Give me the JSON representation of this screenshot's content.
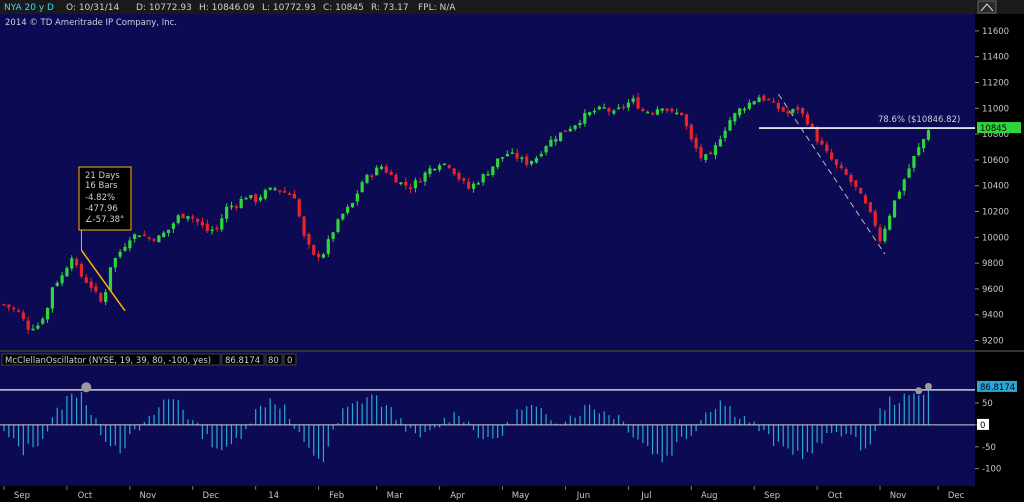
{
  "header": {
    "symbol": "NYA 20 y D",
    "open": "O: 10/31/14",
    "date_open": "D: 10772.93",
    "high": "H: 10846.09",
    "low": "L: 10772.93",
    "close": "C: 10845",
    "range": "R: 73.17",
    "fpl": "FPL: N/A",
    "copyright": "2014 © TD Ameritrade IP Company, Inc."
  },
  "colors": {
    "bg": "#0b0a52",
    "up": "#2fd63a",
    "down": "#e8242a",
    "fib": "#ffffff",
    "osc": "#2aa7d8",
    "annot": "#ffb400"
  },
  "annotation": {
    "lines": [
      "21 Days",
      "16 Bars",
      "-4.82%",
      "-477.96",
      "∠-57.38°"
    ]
  },
  "fib_label": "78.6% ($10846.82)",
  "price_tag": "10845",
  "osc_header": {
    "name": "McClellanOscillator (NYSE, 19, 39, 80, -100, yes)",
    "value": "86.8174",
    "level": "80",
    "zero": "0"
  },
  "osc_tag": "86.8174",
  "osc_zero_tag": "0",
  "chart_data": [
    {
      "type": "candlestick",
      "title": "NYA 20 y D",
      "ylim": [
        9150,
        11700
      ],
      "y_ticks": [
        9200,
        9400,
        9600,
        9800,
        10000,
        10200,
        10400,
        10600,
        10800,
        11000,
        11200,
        11400,
        11600
      ],
      "x_labels": [
        "Sep",
        "Oct",
        "Nov",
        "Dec",
        "14",
        "Feb",
        "Mar",
        "Apr",
        "May",
        "Jun",
        "Jul",
        "Aug",
        "Sep",
        "Oct",
        "Nov",
        "Dec"
      ],
      "x_label_index": [
        0,
        13,
        26,
        39,
        52,
        65,
        77,
        90,
        103,
        116,
        129,
        142,
        155,
        168,
        181,
        193
      ],
      "close_path": [
        [
          0,
          9480
        ],
        [
          3,
          9420
        ],
        [
          5,
          9300
        ],
        [
          7,
          9320
        ],
        [
          9,
          9450
        ],
        [
          10,
          9620
        ],
        [
          12,
          9700
        ],
        [
          14,
          9860
        ],
        [
          15,
          9760
        ],
        [
          16,
          9700
        ],
        [
          18,
          9620
        ],
        [
          20,
          9500
        ],
        [
          21,
          9590
        ],
        [
          22,
          9780
        ],
        [
          24,
          9890
        ],
        [
          26,
          10000
        ],
        [
          28,
          10030
        ],
        [
          30,
          9990
        ],
        [
          32,
          10000
        ],
        [
          34,
          10060
        ],
        [
          36,
          10160
        ],
        [
          38,
          10180
        ],
        [
          40,
          10120
        ],
        [
          42,
          10050
        ],
        [
          44,
          10070
        ],
        [
          46,
          10230
        ],
        [
          48,
          10260
        ],
        [
          50,
          10320
        ],
        [
          52,
          10290
        ],
        [
          54,
          10350
        ],
        [
          56,
          10380
        ],
        [
          58,
          10350
        ],
        [
          60,
          10320
        ],
        [
          62,
          10000
        ],
        [
          64,
          9850
        ],
        [
          66,
          9880
        ],
        [
          68,
          10050
        ],
        [
          70,
          10180
        ],
        [
          72,
          10260
        ],
        [
          74,
          10430
        ],
        [
          76,
          10500
        ],
        [
          78,
          10550
        ],
        [
          80,
          10480
        ],
        [
          82,
          10420
        ],
        [
          84,
          10390
        ],
        [
          86,
          10460
        ],
        [
          88,
          10530
        ],
        [
          90,
          10580
        ],
        [
          92,
          10560
        ],
        [
          94,
          10460
        ],
        [
          96,
          10380
        ],
        [
          98,
          10440
        ],
        [
          100,
          10510
        ],
        [
          102,
          10600
        ],
        [
          104,
          10650
        ],
        [
          106,
          10620
        ],
        [
          108,
          10580
        ],
        [
          110,
          10620
        ],
        [
          112,
          10720
        ],
        [
          114,
          10780
        ],
        [
          116,
          10830
        ],
        [
          118,
          10880
        ],
        [
          120,
          10940
        ],
        [
          122,
          10980
        ],
        [
          124,
          11000
        ],
        [
          126,
          10960
        ],
        [
          128,
          11020
        ],
        [
          130,
          11060
        ],
        [
          132,
          10980
        ],
        [
          134,
          10980
        ],
        [
          136,
          11020
        ],
        [
          138,
          10960
        ],
        [
          140,
          10960
        ],
        [
          142,
          10750
        ],
        [
          144,
          10620
        ],
        [
          146,
          10620
        ],
        [
          148,
          10780
        ],
        [
          150,
          10910
        ],
        [
          152,
          10990
        ],
        [
          154,
          11040
        ],
        [
          156,
          11090
        ],
        [
          158,
          11060
        ],
        [
          160,
          11000
        ],
        [
          162,
          10960
        ],
        [
          164,
          11000
        ],
        [
          166,
          10900
        ],
        [
          168,
          10760
        ],
        [
          170,
          10650
        ],
        [
          172,
          10550
        ],
        [
          174,
          10480
        ],
        [
          176,
          10380
        ],
        [
          178,
          10250
        ],
        [
          180,
          10100
        ],
        [
          181,
          9980
        ],
        [
          182,
          10080
        ],
        [
          184,
          10280
        ],
        [
          186,
          10450
        ],
        [
          188,
          10620
        ],
        [
          190,
          10760
        ],
        [
          191,
          10845
        ]
      ],
      "fib_level": 10846.82,
      "trend_lines": [
        {
          "from": [
            16,
            9900
          ],
          "to": [
            25,
            9430
          ]
        },
        {
          "from": [
            160,
            11110
          ],
          "to": [
            182,
            9870
          ]
        }
      ]
    },
    {
      "type": "bar",
      "title": "McClellanOscillator (NYSE, 19, 39, 80, -100, yes)",
      "ylim": [
        -135,
        130
      ],
      "y_ticks": [
        -100,
        -50,
        0,
        50
      ],
      "reference_level": 80,
      "osc_path": [
        [
          0,
          -20
        ],
        [
          4,
          -60
        ],
        [
          8,
          -30
        ],
        [
          11,
          30
        ],
        [
          13,
          60
        ],
        [
          16,
          80
        ],
        [
          18,
          20
        ],
        [
          21,
          -30
        ],
        [
          24,
          -55
        ],
        [
          27,
          -20
        ],
        [
          30,
          10
        ],
        [
          33,
          55
        ],
        [
          36,
          60
        ],
        [
          38,
          20
        ],
        [
          41,
          -20
        ],
        [
          44,
          -50
        ],
        [
          46,
          -60
        ],
        [
          49,
          -20
        ],
        [
          52,
          30
        ],
        [
          55,
          60
        ],
        [
          58,
          40
        ],
        [
          60,
          -10
        ],
        [
          63,
          -60
        ],
        [
          66,
          -80
        ],
        [
          68,
          -20
        ],
        [
          70,
          30
        ],
        [
          73,
          50
        ],
        [
          76,
          70
        ],
        [
          79,
          40
        ],
        [
          82,
          10
        ],
        [
          85,
          -30
        ],
        [
          88,
          -20
        ],
        [
          91,
          10
        ],
        [
          94,
          30
        ],
        [
          97,
          -10
        ],
        [
          100,
          -40
        ],
        [
          103,
          -20
        ],
        [
          106,
          30
        ],
        [
          109,
          40
        ],
        [
          112,
          20
        ],
        [
          115,
          10
        ],
        [
          118,
          25
        ],
        [
          121,
          45
        ],
        [
          124,
          30
        ],
        [
          127,
          20
        ],
        [
          130,
          -20
        ],
        [
          133,
          -50
        ],
        [
          136,
          -80
        ],
        [
          138,
          -60
        ],
        [
          140,
          -30
        ],
        [
          142,
          -20
        ],
        [
          145,
          30
        ],
        [
          148,
          55
        ],
        [
          151,
          30
        ],
        [
          154,
          10
        ],
        [
          157,
          -20
        ],
        [
          160,
          -50
        ],
        [
          163,
          -60
        ],
        [
          166,
          -70
        ],
        [
          169,
          -40
        ],
        [
          172,
          -10
        ],
        [
          174,
          -20
        ],
        [
          176,
          -40
        ],
        [
          178,
          -55
        ],
        [
          180,
          -20
        ],
        [
          181,
          30
        ],
        [
          183,
          55
        ],
        [
          186,
          60
        ],
        [
          189,
          70
        ],
        [
          191,
          86.8
        ]
      ],
      "markers": [
        {
          "x": 17,
          "y": 86
        },
        {
          "x": 189,
          "y": 78
        },
        {
          "x": 191,
          "y": 88
        }
      ]
    }
  ]
}
